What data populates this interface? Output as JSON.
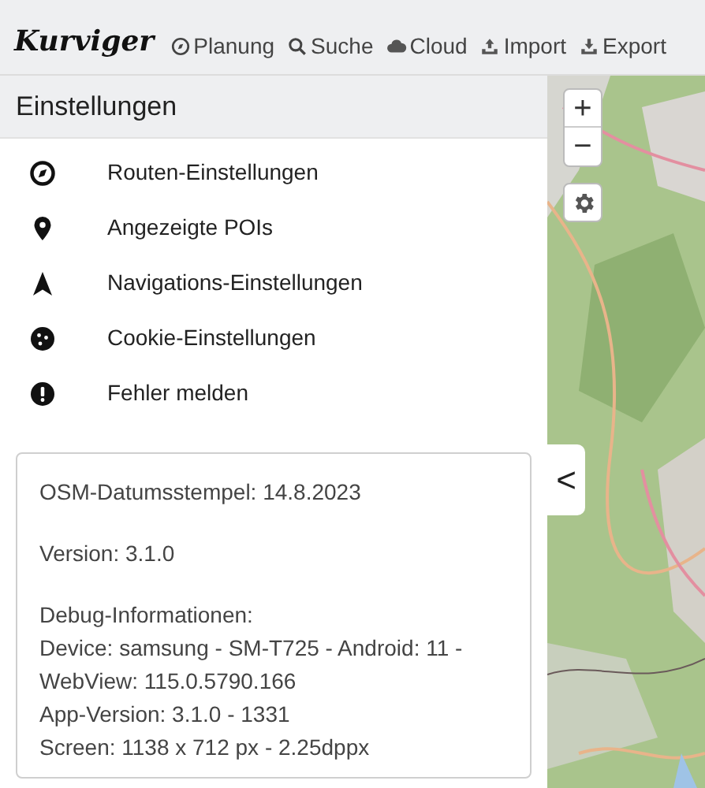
{
  "app_bar": {
    "logo": "Kurviger",
    "nav": [
      {
        "kind": "planning",
        "label": "Planung"
      },
      {
        "kind": "search",
        "label": "Suche"
      },
      {
        "kind": "cloud",
        "label": "Cloud"
      },
      {
        "kind": "import",
        "label": "Import"
      },
      {
        "kind": "export",
        "label": "Export"
      }
    ]
  },
  "settings": {
    "title": "Einstellungen",
    "items": [
      {
        "kind": "route",
        "label": "Routen-Einstellungen"
      },
      {
        "kind": "poi",
        "label": "Angezeigte POIs"
      },
      {
        "kind": "navigation",
        "label": "Navigations-Einstellungen"
      },
      {
        "kind": "cookie",
        "label": "Cookie-Einstellungen"
      },
      {
        "kind": "error",
        "label": "Fehler melden"
      }
    ]
  },
  "info_card": {
    "osm_timestamp": "OSM-Datumsstempel: 14.8.2023",
    "version": "Version: 3.1.0",
    "debug_lines": [
      "Debug-Informationen:",
      "Device: samsung - SM-T725 - Android: 11 - WebView: 115.0.5790.166",
      "App-Version: 3.1.0 - 1331",
      "Screen: 1138 x 712 px - 2.25dppx"
    ]
  },
  "map": {
    "zoom_in": "+",
    "zoom_out": "−",
    "collapse": "<"
  }
}
